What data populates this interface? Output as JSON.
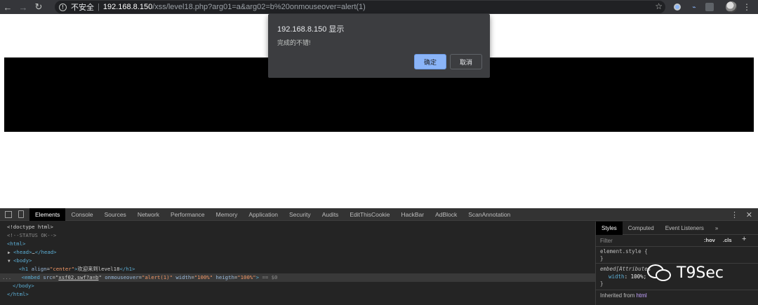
{
  "browser": {
    "back_icon": "arrow-left",
    "forward_icon": "arrow-right",
    "reload_icon": "reload",
    "insecure_label": "不安全",
    "url_host": "192.168.8.150",
    "url_path": "/xss/level18.php?arg01=a&arg02=b%20onmouseover=alert(1)"
  },
  "alert": {
    "title": "192.168.8.150 显示",
    "message": "完成的不错!",
    "ok_label": "确定",
    "cancel_label": "取消"
  },
  "devtools": {
    "tabs": [
      "Elements",
      "Console",
      "Sources",
      "Network",
      "Performance",
      "Memory",
      "Application",
      "Security",
      "Audits",
      "EditThisCookie",
      "HackBar",
      "AdBlock",
      "ScanAnnotation"
    ],
    "dom": {
      "doctype": "<!doctype html>",
      "comment": "<!--STATUS OK-->",
      "html_open": "<html>",
      "head_open": "<head>",
      "head_ellipsis": "…",
      "head_close": "</head>",
      "body_open": "<body>",
      "h1_open": "<h1",
      "h1_attr": "align",
      "h1_val": "\"center\"",
      "h1_text": "欢迎来到level18",
      "h1_close": "</h1>",
      "embed_open": "<embed",
      "src_attr": "src",
      "src_val": "xsf02.swf?a=b",
      "onmouse_attr": "onmouseover",
      "onmouse_val": "\"alert(1)\"",
      "width_attr": "width",
      "width_val": "\"100%\"",
      "heigth_attr": "heigth",
      "heigth_val": "\"100%\"",
      "embed_end": ">",
      "selected_marker": "== $0",
      "body_close": "</body>",
      "html_close": "</html>",
      "row_dots": "..."
    },
    "styles": {
      "tabs": [
        "Styles",
        "Computed",
        "Event Listeners"
      ],
      "more": "»",
      "filter_placeholder": "Filter",
      "hov": ":hov",
      "cls": ".cls",
      "plus": "+",
      "element_style": "element.style {",
      "close_brace": "}",
      "rule_selector": "embed[Attributes",
      "prop_name": "width",
      "prop_value": "100%;",
      "inherited_label": "Inherited from",
      "inherited_tag": "html"
    }
  },
  "watermark": {
    "text": "T9Sec"
  }
}
